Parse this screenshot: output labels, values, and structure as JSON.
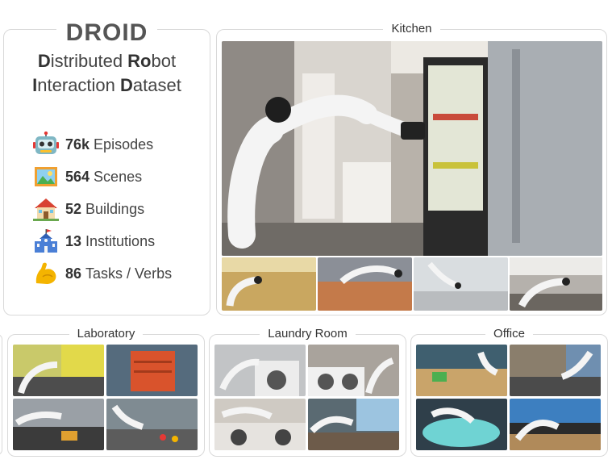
{
  "droid": {
    "title": "DROID",
    "subtitle_line1": [
      {
        "b": "D",
        "r": "istributed "
      },
      {
        "b": "Ro",
        "r": "bot"
      }
    ],
    "subtitle_line2": [
      {
        "b": "I",
        "r": "nteraction "
      },
      {
        "b": "D",
        "r": "ataset"
      }
    ],
    "stats": [
      {
        "icon": "robot-icon",
        "num": "76k",
        "label": "Episodes"
      },
      {
        "icon": "picture-icon",
        "num": "564",
        "label": "Scenes"
      },
      {
        "icon": "house-icon",
        "num": "52",
        "label": "Buildings"
      },
      {
        "icon": "school-icon",
        "num": "13",
        "label": "Institutions"
      },
      {
        "icon": "flexed-biceps-icon",
        "num": "86",
        "label": "Tasks / Verbs"
      }
    ]
  },
  "scenes": {
    "kitchen": "Kitchen",
    "laboratory": "Laboratory",
    "laundry": "Laundry Room",
    "office": "Office"
  }
}
